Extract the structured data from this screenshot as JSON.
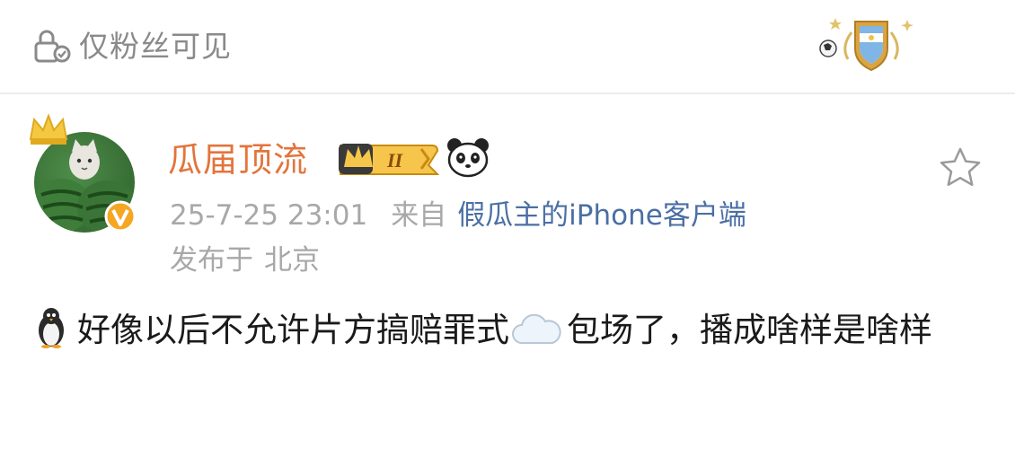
{
  "topbar": {
    "visibility_label": "仅粉丝可见",
    "visibility_icon": "lock-person-icon",
    "badge_icon": "argentina-shield-badge-icon"
  },
  "post": {
    "author": {
      "name": "瓜届顶流",
      "vip_level": "II",
      "avatar_icon": "watermelon-cat-avatar",
      "crown_icon": "crown-icon",
      "verified_icon": "verified-v-icon",
      "extra_icon": "panda-icon"
    },
    "timestamp": "25-7-25 23:01",
    "from_label": "来自",
    "client": "假瓜主的iPhone客户端",
    "location_label": "发布于",
    "location": "北京",
    "favorite_icon": "star-icon",
    "text_part1": "好像以后不允许片方搞赔罪式",
    "text_part2": "包场了，播成啥样是啥样",
    "emoji_1": "penguin-emoji",
    "emoji_2": "cloud-emoji"
  },
  "colors": {
    "username": "#e3743c",
    "link": "#4a6fa5",
    "meta": "#a8a8a8",
    "muted": "#8a8a8a"
  }
}
